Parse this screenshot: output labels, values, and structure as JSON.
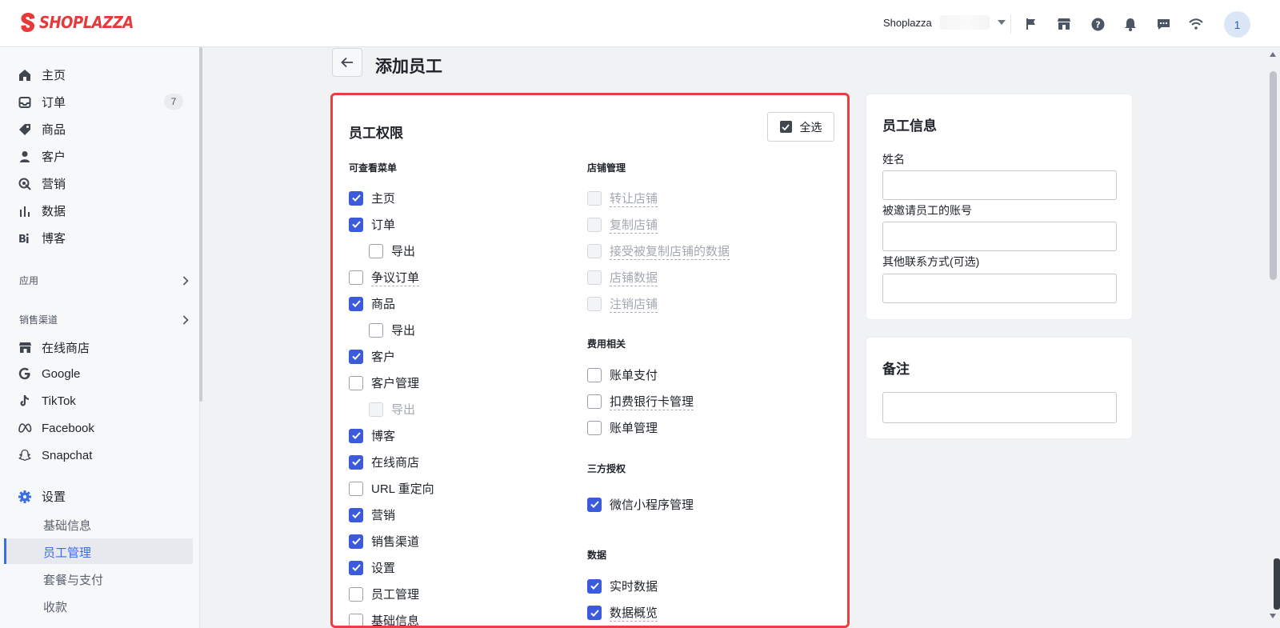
{
  "header": {
    "logo_text": "SHOPLAZZA",
    "store_name": "Shoplazza",
    "avatar_initial": "1",
    "brand_color": "#e63a3a"
  },
  "sidebar": {
    "items": [
      {
        "label": "主页",
        "icon": "home-icon"
      },
      {
        "label": "订单",
        "icon": "inbox-icon",
        "badge": "7"
      },
      {
        "label": "商品",
        "icon": "tag-icon"
      },
      {
        "label": "客户",
        "icon": "person-icon"
      },
      {
        "label": "营销",
        "icon": "target-icon"
      },
      {
        "label": "数据",
        "icon": "bar-chart-icon"
      },
      {
        "label": "博客",
        "icon": "blog-icon"
      }
    ],
    "apps_label": "应用",
    "channels_label": "销售渠道",
    "channels": [
      {
        "label": "在线商店",
        "icon": "store-icon"
      },
      {
        "label": "Google",
        "icon": "google-icon"
      },
      {
        "label": "TikTok",
        "icon": "tiktok-icon"
      },
      {
        "label": "Facebook",
        "icon": "meta-icon"
      },
      {
        "label": "Snapchat",
        "icon": "snapchat-icon"
      }
    ],
    "settings_label": "设置",
    "settings_sub": [
      "基础信息",
      "员工管理",
      "套餐与支付",
      "收款"
    ],
    "active_sub": "员工管理",
    "accent_color": "#3b6ee6"
  },
  "page": {
    "title": "添加员工"
  },
  "permissions": {
    "title": "员工权限",
    "select_all": "全选",
    "menu_group_title": "可查看菜单",
    "menu_items": [
      {
        "label": "主页",
        "checked": true
      },
      {
        "label": "订单",
        "checked": true
      },
      {
        "label": "导出",
        "checked": false
      },
      {
        "label": "争议订单",
        "checked": false
      },
      {
        "label": "商品",
        "checked": true
      },
      {
        "label": "导出",
        "checked": false
      },
      {
        "label": "客户",
        "checked": true
      },
      {
        "label": "客户管理",
        "checked": false
      },
      {
        "label": "导出",
        "checked": false,
        "disabled": true
      },
      {
        "label": "博客",
        "checked": true
      },
      {
        "label": "在线商店",
        "checked": true
      },
      {
        "label": "URL 重定向",
        "checked": false
      },
      {
        "label": "营销",
        "checked": true
      },
      {
        "label": "销售渠道",
        "checked": true
      },
      {
        "label": "设置",
        "checked": true
      },
      {
        "label": "员工管理",
        "checked": false
      },
      {
        "label": "基础信息",
        "checked": false
      }
    ],
    "shop_group_title": "店铺管理",
    "shop_items": [
      {
        "label": "转让店铺",
        "disabled": true
      },
      {
        "label": "复制店铺",
        "disabled": true
      },
      {
        "label": "接受被复制店铺的数据",
        "disabled": true
      },
      {
        "label": "店铺数据",
        "disabled": true
      },
      {
        "label": "注销店铺",
        "disabled": true
      }
    ],
    "fee_group_title": "费用相关",
    "fee_items": [
      {
        "label": "账单支付",
        "checked": false
      },
      {
        "label": "扣费银行卡管理",
        "checked": false
      },
      {
        "label": "账单管理",
        "checked": false
      }
    ],
    "auth_group_title": "三方授权",
    "auth_items": [
      {
        "label": "微信小程序管理",
        "checked": true
      }
    ],
    "data_group_title": "数据",
    "data_items": [
      {
        "label": "实时数据",
        "checked": true
      },
      {
        "label": "数据概览",
        "checked": true
      }
    ],
    "highlight_color": "#e8403e",
    "check_color": "#3b5bdb"
  },
  "staff_info": {
    "title": "员工信息",
    "name_label": "姓名",
    "name_value": "",
    "account_label": "被邀请员工的账号",
    "account_value": "",
    "contact_label": "其他联系方式(可选)",
    "contact_value": ""
  },
  "notes": {
    "title": "备注",
    "value": ""
  }
}
